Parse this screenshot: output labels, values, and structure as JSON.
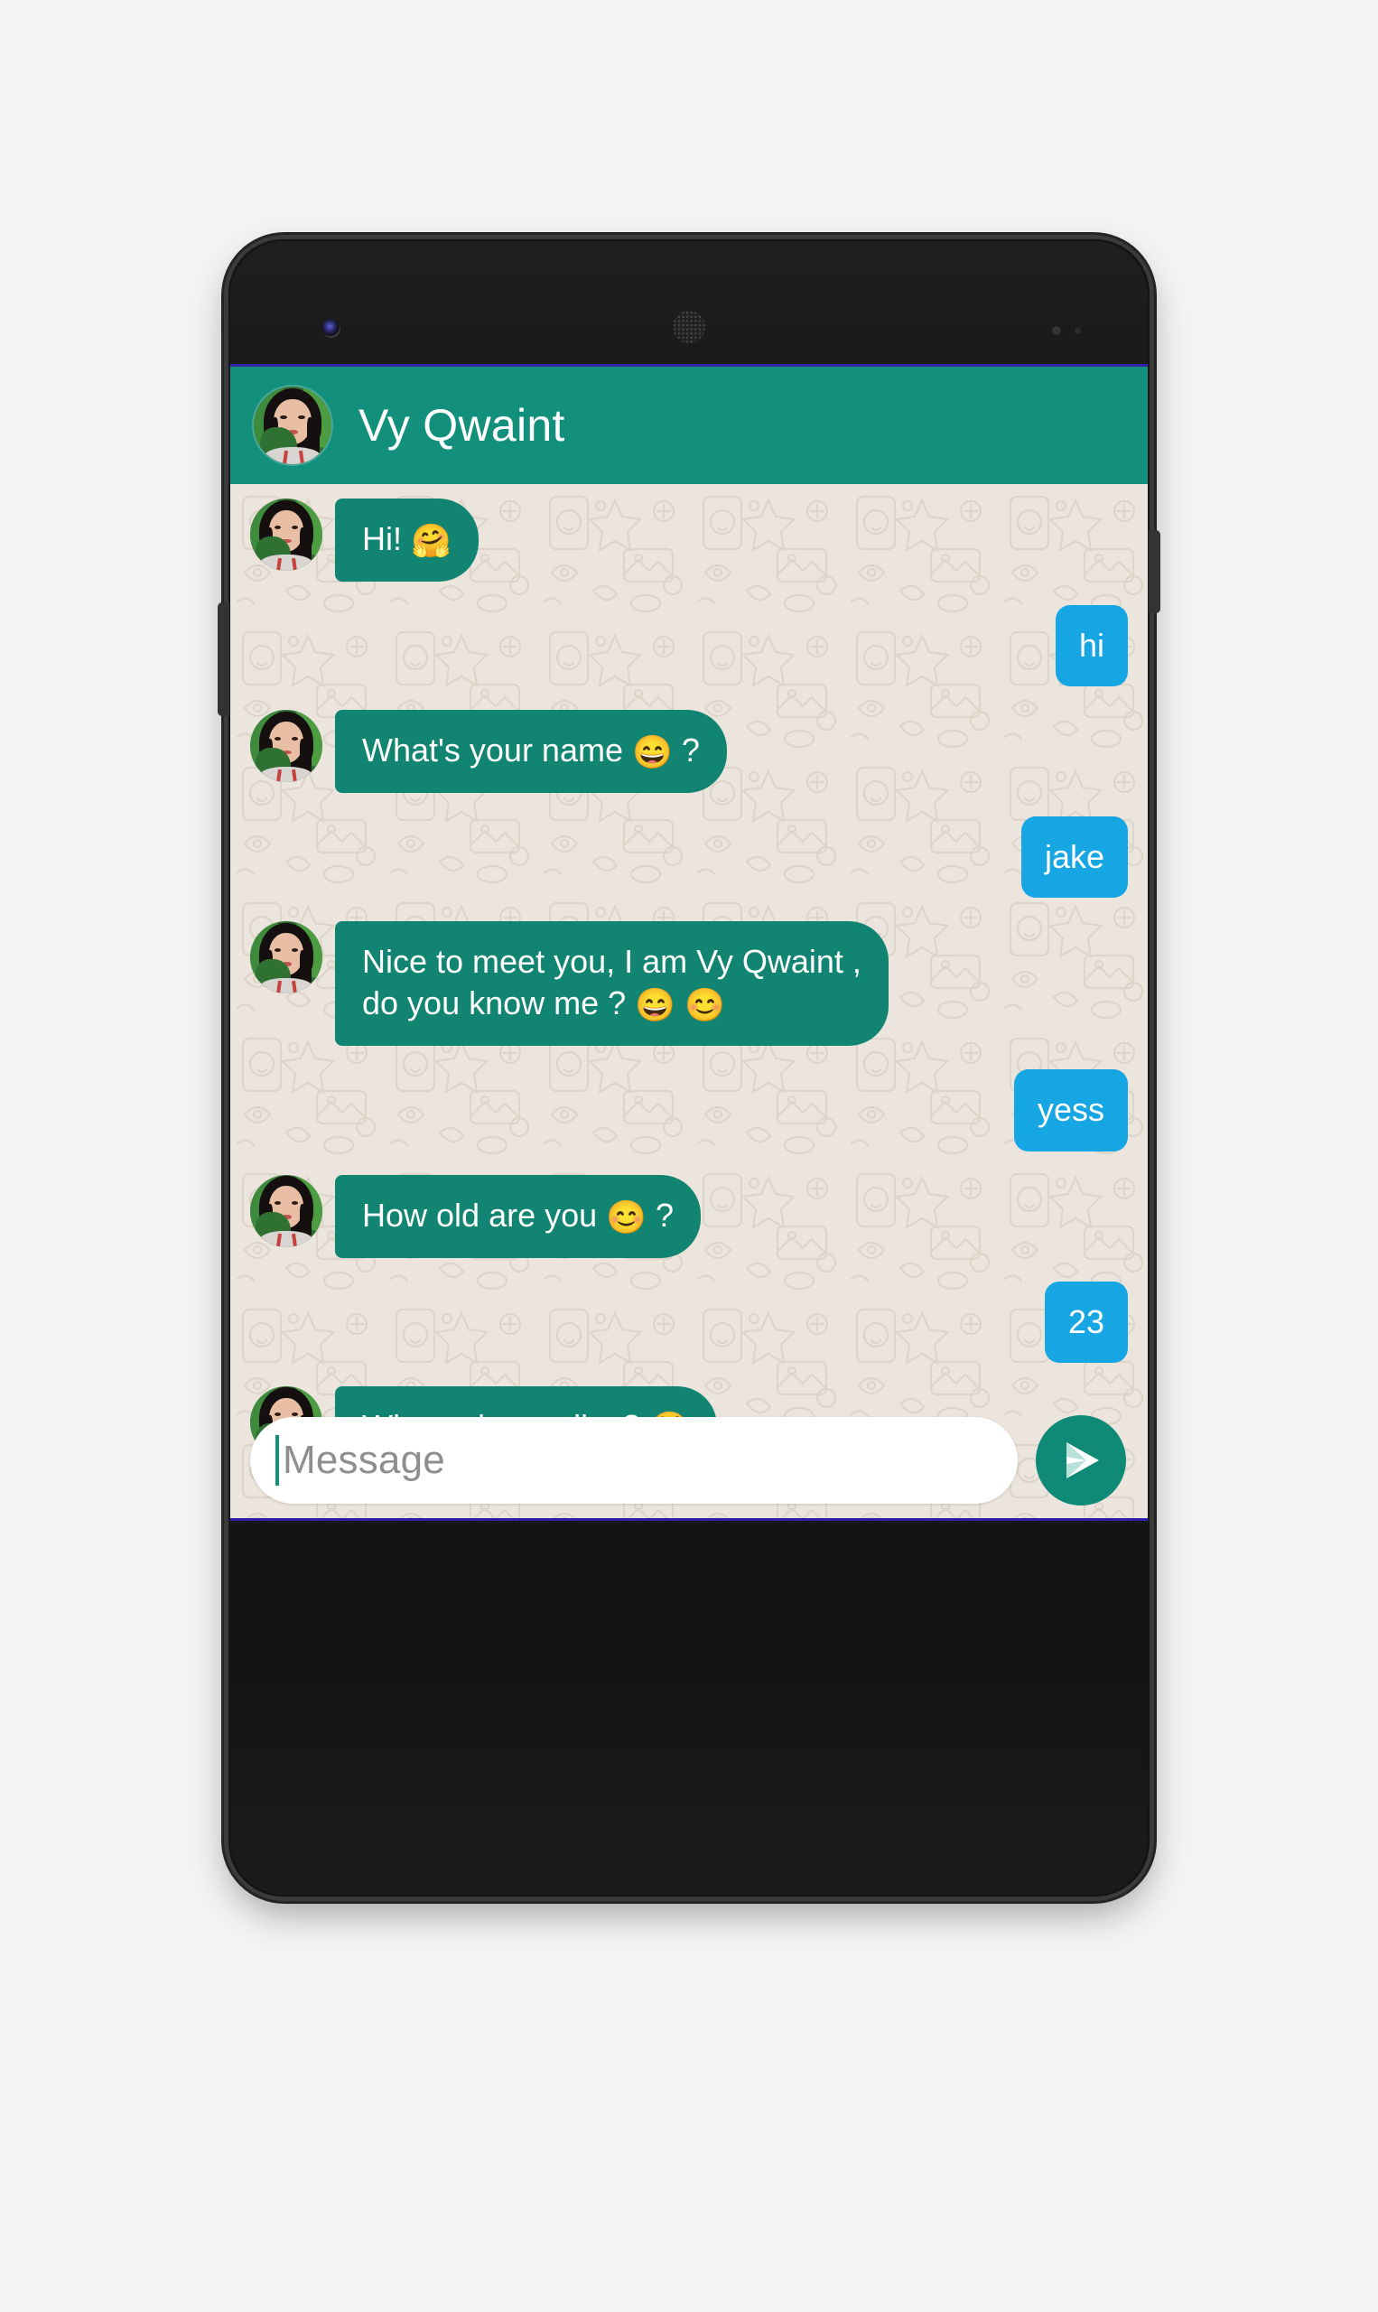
{
  "app": {
    "name": "whatsapp-chat-mockup",
    "accent_teal": "#12907c",
    "bubble_in_color": "#128572",
    "bubble_out_color": "#16a6e4",
    "chat_background": "#ece5dd",
    "screen_border_color": "#2d1ea8"
  },
  "header": {
    "contact_name": "Vy Qwaint",
    "avatar_alt": "contact-avatar"
  },
  "messages": [
    {
      "id": 1,
      "side": "incoming",
      "text": "Hi! ",
      "emoji": "🤗",
      "avatar": true
    },
    {
      "id": 2,
      "side": "outgoing",
      "text": "hi",
      "emoji": "",
      "avatar": false
    },
    {
      "id": 3,
      "side": "incoming",
      "text": "What's your name ",
      "emoji": "😄",
      "suffix": " ?",
      "avatar": true
    },
    {
      "id": 4,
      "side": "outgoing",
      "text": "jake",
      "emoji": "",
      "avatar": false
    },
    {
      "id": 5,
      "side": "incoming",
      "text": "Nice to meet you, I am Vy Qwaint ,\ndo you know me  ? ",
      "emoji": "😄 😊",
      "avatar": true
    },
    {
      "id": 6,
      "side": "outgoing",
      "text": "yess",
      "emoji": "",
      "avatar": false
    },
    {
      "id": 7,
      "side": "incoming",
      "text": "How old are you ",
      "emoji": "😊",
      "suffix": " ?",
      "avatar": true
    },
    {
      "id": 8,
      "side": "outgoing",
      "text": "23",
      "emoji": "",
      "avatar": false
    },
    {
      "id": 9,
      "side": "incoming",
      "text": "Where do you live? ",
      "emoji": "😤",
      "avatar": true
    }
  ],
  "composer": {
    "placeholder": "Message",
    "value": "",
    "send_label": "send-icon"
  },
  "m1": {
    "text": "Hi! ",
    "emoji": "🤗"
  },
  "m2": {
    "text": "hi"
  },
  "m3": {
    "text": "What's your name ",
    "emoji": "😄",
    "suffix": " ?"
  },
  "m4": {
    "text": "jake"
  },
  "m5": {
    "line1": "Nice to meet you, I am Vy Qwaint ,",
    "line2": "do you know me  ? ",
    "emoji": "😄 😊"
  },
  "m6": {
    "text": "yess"
  },
  "m7": {
    "text": "How old are you ",
    "emoji": "😊",
    "suffix": " ?"
  },
  "m8": {
    "text": "23"
  },
  "m9": {
    "text": "Where do you live? ",
    "emoji": "😤"
  }
}
